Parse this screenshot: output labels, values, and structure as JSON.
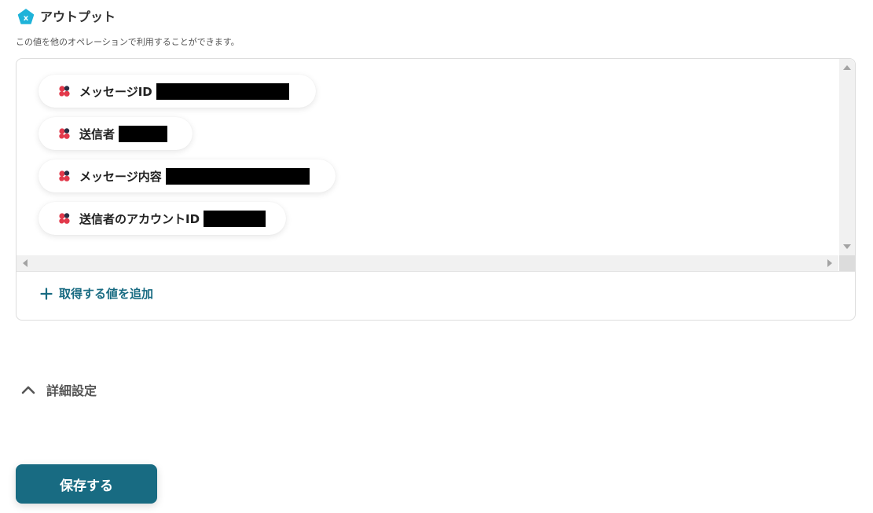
{
  "section": {
    "title": "アウトプット",
    "description": "この値を他のオペレーションで利用することができます。",
    "icon": "x-variable-icon"
  },
  "output_items": [
    {
      "label": "メッセージID",
      "icon": "chatwork-icon",
      "value_redacted": true
    },
    {
      "label": "送信者",
      "icon": "chatwork-icon",
      "value_redacted": true
    },
    {
      "label": "メッセージ内容",
      "icon": "chatwork-icon",
      "value_redacted": true
    },
    {
      "label": "送信者のアカウントID",
      "icon": "chatwork-icon",
      "value_redacted": true
    }
  ],
  "add_value": {
    "label": "取得する値を追加",
    "icon": "plus-icon"
  },
  "advanced": {
    "label": "詳細設定",
    "icon": "chevron-up-icon"
  },
  "save_button": {
    "label": "保存する"
  },
  "colors": {
    "accent": "#186b82",
    "icon_teal": "#1fb3d9",
    "chatwork_red": "#e2394b",
    "chatwork_dark": "#2a2f45"
  }
}
